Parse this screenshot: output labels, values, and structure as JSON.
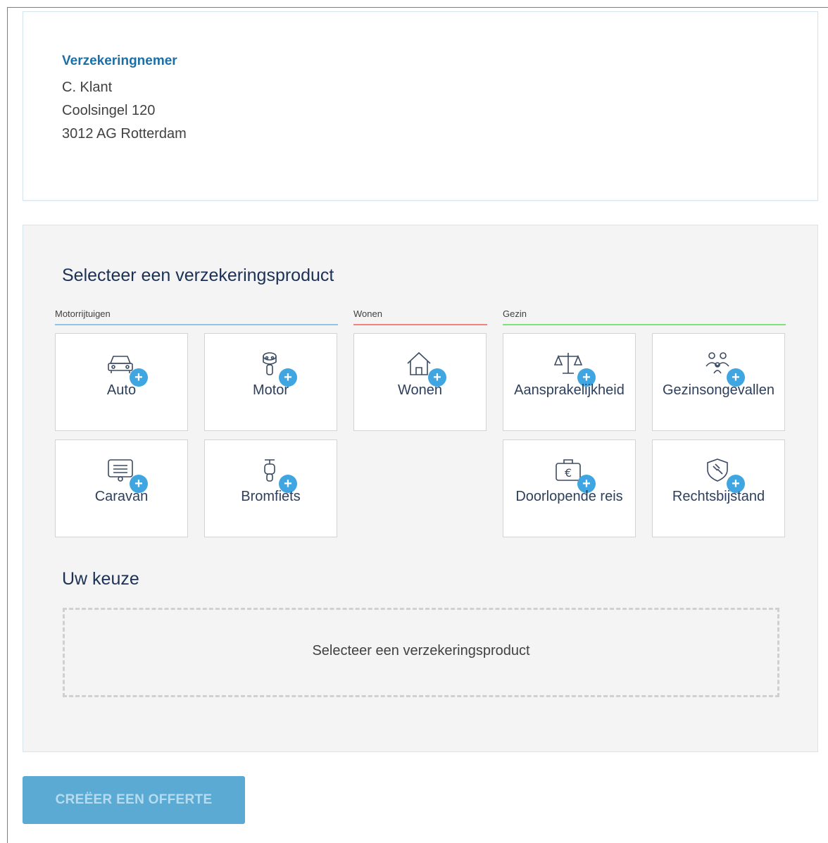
{
  "policyholder": {
    "title": "Verzekeringnemer",
    "name": "C. Klant",
    "street": "Coolsingel 120",
    "city": "3012 AG Rotterdam"
  },
  "product_selection": {
    "title": "Selecteer een verzekeringsproduct",
    "categories": [
      {
        "label": "Motorrijtuigen",
        "color": "#8fc4e6"
      },
      {
        "label": "Wonen",
        "color": "#f0847d"
      },
      {
        "label": "Gezin",
        "color": "#7ee27a"
      }
    ],
    "products": [
      {
        "label": "Auto",
        "icon": "car-icon"
      },
      {
        "label": "Motor",
        "icon": "motorcycle-icon"
      },
      {
        "label": "Wonen",
        "icon": "house-icon"
      },
      {
        "label": "Aansprakelijkheid",
        "icon": "scales-icon"
      },
      {
        "label": "Gezinsongevallen",
        "icon": "family-icon"
      },
      {
        "label": "Caravan",
        "icon": "caravan-icon"
      },
      {
        "label": "Bromfiets",
        "icon": "moped-icon"
      },
      {
        "label": "Doorlopende reis",
        "icon": "suitcase-euro-icon"
      },
      {
        "label": "Rechtsbijstand",
        "icon": "shield-gavel-icon"
      }
    ],
    "add_symbol": "+"
  },
  "choice": {
    "title": "Uw keuze",
    "placeholder": "Selecteer een verzekeringsproduct"
  },
  "actions": {
    "create_quote_label": "CREËER EEN OFFERTE"
  },
  "colors": {
    "accent": "#3fa6e1",
    "title": "#1b6fa8",
    "button": "#5aaad4"
  }
}
